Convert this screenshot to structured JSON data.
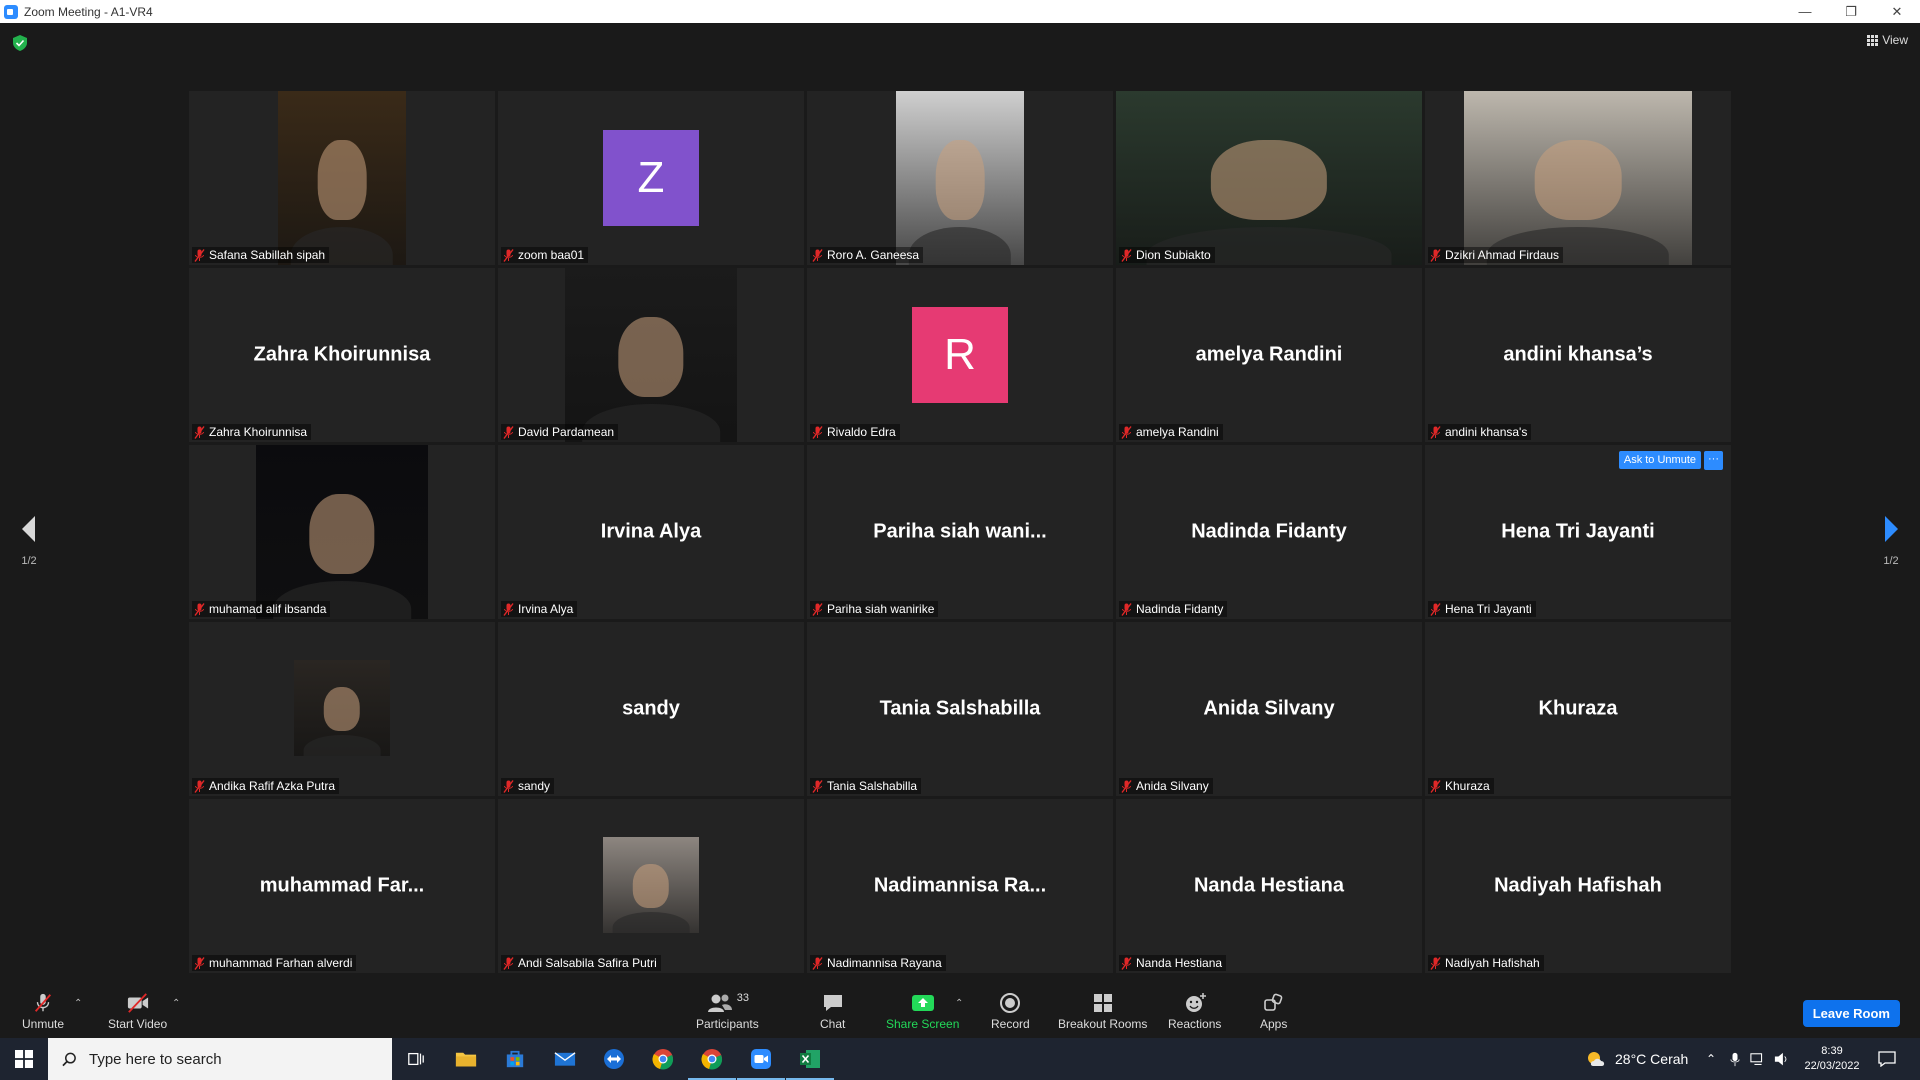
{
  "window": {
    "title": "Zoom Meeting - A1-VR4"
  },
  "top": {
    "view_label": "View"
  },
  "tiles": [
    {
      "label": "Safana Sabillah sipah",
      "big": "",
      "kind": "photo",
      "photo_color": "#3a2a18"
    },
    {
      "label": "zoom baa01",
      "big": "",
      "kind": "avatar",
      "avatar_letter": "Z",
      "avatar_color": "#8152cc"
    },
    {
      "label": "Roro A. Ganeesa",
      "big": "",
      "kind": "photo",
      "photo_color": "#cfcfcf"
    },
    {
      "label": "Dion Subiakto",
      "big": "",
      "kind": "photo",
      "photo_color": "#2b3a2e",
      "active": true
    },
    {
      "label": "Dzikri Ahmad Firdaus",
      "big": "",
      "kind": "photo",
      "photo_color": "#bdb7ad"
    },
    {
      "label": "Zahra Khoirunnisa",
      "big": "Zahra Khoirunnisa",
      "kind": "name"
    },
    {
      "label": "David Pardamean",
      "big": "",
      "kind": "photo",
      "photo_color": "#1b1b1b"
    },
    {
      "label": "Rivaldo Edra",
      "big": "",
      "kind": "avatar",
      "avatar_letter": "R",
      "avatar_color": "#e63a73"
    },
    {
      "label": "amelya Randini",
      "big": "amelya Randini",
      "kind": "name"
    },
    {
      "label": "andini khansa's",
      "big": "andini khansa’s",
      "kind": "name"
    },
    {
      "label": "muhamad alif ibsanda",
      "big": "",
      "kind": "photo",
      "photo_color": "#0b0b0e"
    },
    {
      "label": "Irvina Alya",
      "big": "Irvina Alya",
      "kind": "name"
    },
    {
      "label": "Pariha siah wanirike",
      "big": "Pariha siah wani...",
      "kind": "name"
    },
    {
      "label": "Nadinda Fidanty",
      "big": "Nadinda Fidanty",
      "kind": "name"
    },
    {
      "label": "Hena Tri Jayanti",
      "big": "Hena Tri Jayanti",
      "kind": "name",
      "ask": true
    },
    {
      "label": "Andika Rafif Azka Putra",
      "big": "",
      "kind": "smallphoto",
      "photo_color": "#2a2622"
    },
    {
      "label": "sandy",
      "big": "sandy",
      "kind": "name"
    },
    {
      "label": "Tania Salshabilla",
      "big": "Tania Salshabilla",
      "kind": "name"
    },
    {
      "label": "Anida Silvany",
      "big": "Anida Silvany",
      "kind": "name"
    },
    {
      "label": "Khuraza",
      "big": "Khuraza",
      "kind": "name"
    },
    {
      "label": "muhammad Farhan alverdi",
      "big": "muhammad  Far...",
      "kind": "name"
    },
    {
      "label": "Andi Salsabila Safira Putri",
      "big": "",
      "kind": "smallphoto",
      "photo_color": "#8d8680"
    },
    {
      "label": "Nadimannisa Rayana",
      "big": "Nadimannisa  Ra...",
      "kind": "name"
    },
    {
      "label": "Nanda Hestiana",
      "big": "Nanda Hestiana",
      "kind": "name"
    },
    {
      "label": "Nadiyah Hafishah",
      "big": "Nadiyah Hafishah",
      "kind": "name"
    }
  ],
  "ask_unmute": {
    "label": "Ask to Unmute",
    "more": "···"
  },
  "pager": {
    "left": "1/2",
    "right": "1/2"
  },
  "toolbar": {
    "unmute": "Unmute",
    "start_video": "Start Video",
    "participants": "Participants",
    "participants_count": "33",
    "chat": "Chat",
    "share_screen": "Share Screen",
    "record": "Record",
    "breakout": "Breakout Rooms",
    "reactions": "Reactions",
    "apps": "Apps",
    "leave": "Leave Room"
  },
  "taskbar": {
    "search_placeholder": "Type here to search",
    "weather": "28°C  Cerah",
    "time": "8:39",
    "date": "22/03/2022"
  },
  "colors": {
    "accent": "#2d8cff",
    "share_green": "#23d959",
    "active_speaker": "#f5f578",
    "mute_red": "#e02828"
  }
}
